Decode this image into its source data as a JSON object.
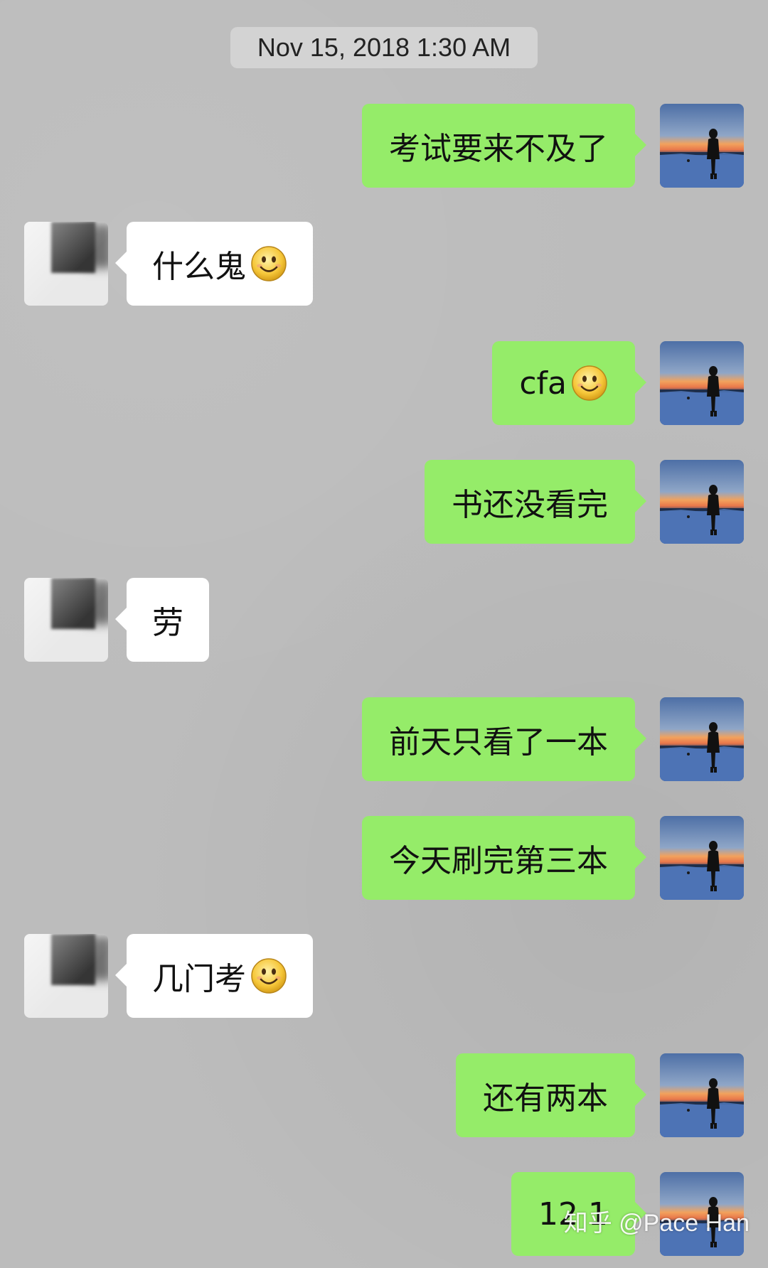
{
  "timestamp": "Nov 15, 2018 1:30 AM",
  "messages": [
    {
      "side": "me",
      "text": "考试要来不及了",
      "emoji": false
    },
    {
      "side": "them",
      "text": "什么鬼",
      "emoji": true,
      "emoji_icon": "smiley-icon"
    },
    {
      "side": "me",
      "text": "cfa",
      "emoji": true,
      "emoji_icon": "smiley-icon"
    },
    {
      "side": "me",
      "text": "书还没看完",
      "emoji": false
    },
    {
      "side": "them",
      "text": "劳",
      "emoji": false
    },
    {
      "side": "me",
      "text": "前天只看了一本",
      "emoji": false
    },
    {
      "side": "me",
      "text": "今天刷完第三本",
      "emoji": false
    },
    {
      "side": "them",
      "text": "几门考",
      "emoji": true,
      "emoji_icon": "smiley-icon"
    },
    {
      "side": "me",
      "text": "还有两本",
      "emoji": false
    },
    {
      "side": "me",
      "text": "12 1",
      "emoji": false
    }
  ],
  "watermark": "知乎 @Pace Han",
  "colors": {
    "background": "#bcbcbc",
    "me_bubble": "#95ec69",
    "them_bubble": "#ffffff",
    "timestamp_bg": "#d3d3d3"
  }
}
